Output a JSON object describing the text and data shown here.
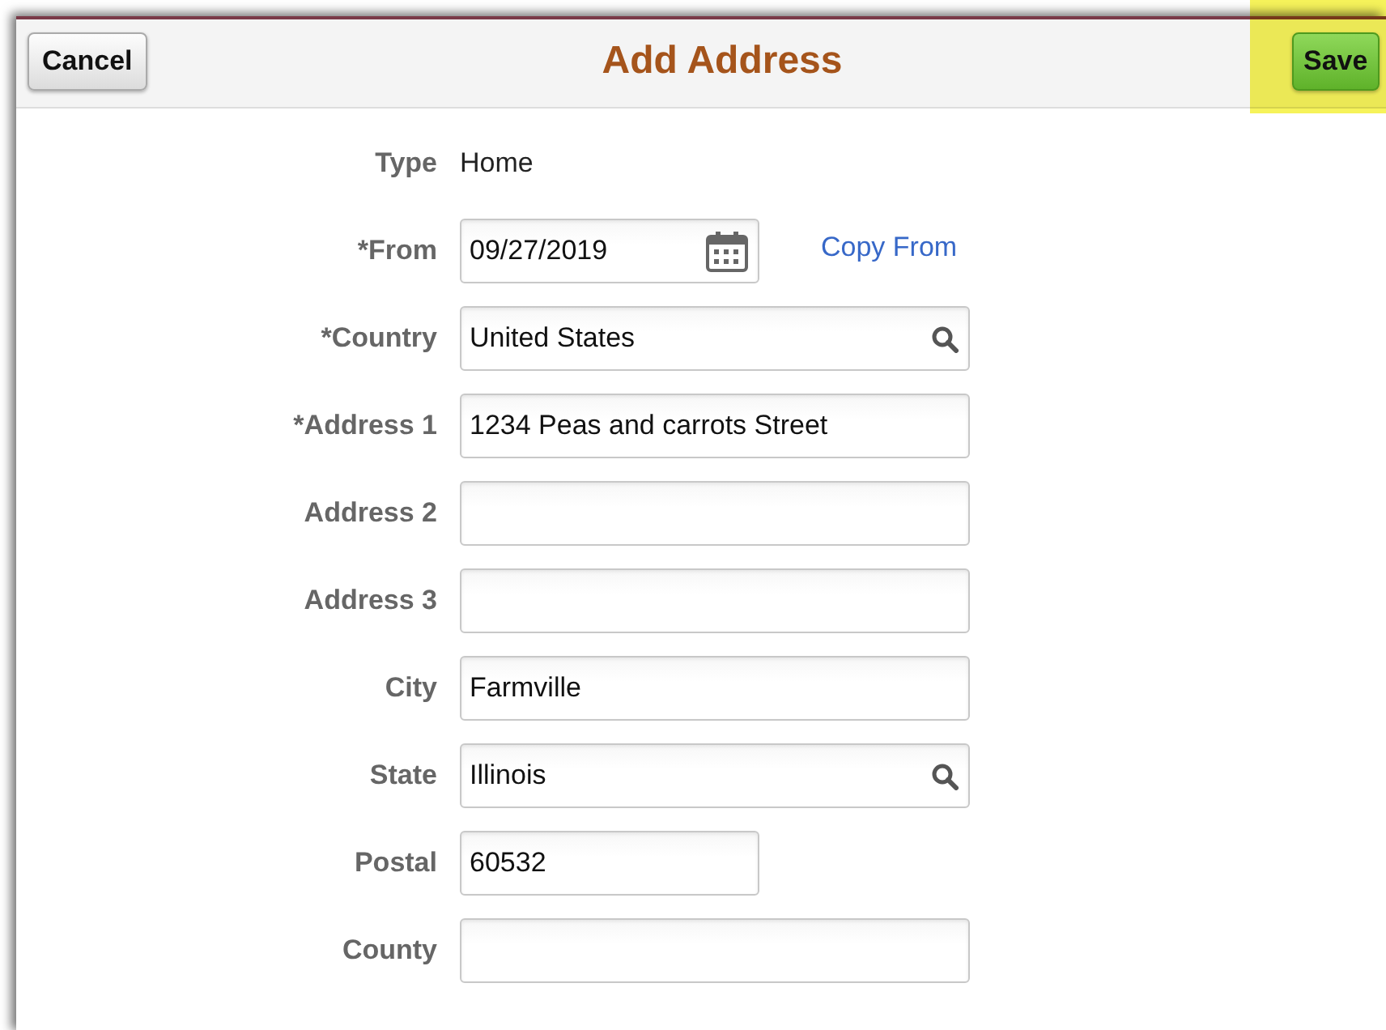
{
  "header": {
    "title": "Add Address",
    "cancel_button": "Cancel",
    "save_button": "Save",
    "save_highlighted": true
  },
  "fields": [
    {
      "kind": "static",
      "label": "Type",
      "value": "Home"
    },
    {
      "kind": "date",
      "label": "*From",
      "value": "09/27/2019",
      "link": "Copy From"
    },
    {
      "kind": "lookup",
      "label": "*Country",
      "value": "United States"
    },
    {
      "kind": "text",
      "label": "*Address 1",
      "value": "1234 Peas and carrots Street"
    },
    {
      "kind": "text",
      "label": "Address 2"
    },
    {
      "kind": "text",
      "label": "Address 3"
    },
    {
      "kind": "text",
      "label": "City",
      "value": "Farmville"
    },
    {
      "kind": "lookup",
      "label": "State",
      "value": "Illinois"
    },
    {
      "kind": "short",
      "label": "Postal",
      "value": "60532"
    },
    {
      "kind": "text",
      "label": "County"
    }
  ]
}
